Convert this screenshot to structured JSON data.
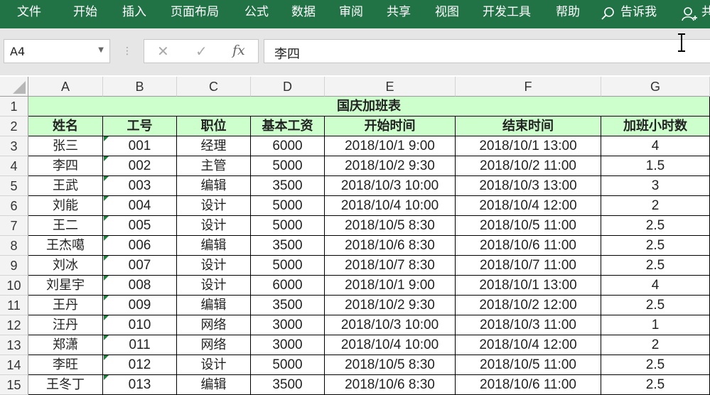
{
  "ribbon": {
    "tabs": [
      "文件",
      "开始",
      "插入",
      "页面布局",
      "公式",
      "数据",
      "审阅",
      "共享",
      "视图",
      "开发工具",
      "帮助"
    ],
    "tell_me": "告诉我",
    "share_partial": "共",
    "accent": "#217346"
  },
  "formula_bar": {
    "name_box": "A4",
    "cancel_icon": "✕",
    "enter_icon": "✓",
    "fx_label": "fx",
    "value": "李四"
  },
  "columns": [
    "A",
    "B",
    "C",
    "D",
    "E",
    "F",
    "G"
  ],
  "rows": [
    "1",
    "2",
    "3",
    "4",
    "5",
    "6",
    "7",
    "8",
    "9",
    "10",
    "11",
    "12",
    "13",
    "14",
    "15"
  ],
  "sheet": {
    "title": "国庆加班表",
    "headers": [
      "姓名",
      "工号",
      "职位",
      "基本工资",
      "开始时间",
      "结束时间",
      "加班小时数"
    ],
    "data": [
      [
        "张三",
        "001",
        "经理",
        "6000",
        "2018/10/1 9:00",
        "2018/10/1 13:00",
        "4"
      ],
      [
        "李四",
        "002",
        "主管",
        "5000",
        "2018/10/2 9:30",
        "2018/10/2 11:00",
        "1.5"
      ],
      [
        "王武",
        "003",
        "编辑",
        "3500",
        "2018/10/3 10:00",
        "2018/10/3 13:00",
        "3"
      ],
      [
        "刘能",
        "004",
        "设计",
        "5000",
        "2018/10/4 10:00",
        "2018/10/4 12:00",
        "2"
      ],
      [
        "王二",
        "005",
        "设计",
        "5000",
        "2018/10/5 8:30",
        "2018/10/5 11:00",
        "2.5"
      ],
      [
        "王杰噶",
        "006",
        "编辑",
        "3500",
        "2018/10/6 8:30",
        "2018/10/6 11:00",
        "2.5"
      ],
      [
        "刘冰",
        "007",
        "设计",
        "5000",
        "2018/10/7 8:30",
        "2018/10/7 11:00",
        "2.5"
      ],
      [
        "刘星宇",
        "008",
        "设计",
        "6000",
        "2018/10/1 9:00",
        "2018/10/1 13:00",
        "4"
      ],
      [
        "王丹",
        "009",
        "编辑",
        "3500",
        "2018/10/2 9:30",
        "2018/10/2 12:00",
        "2.5"
      ],
      [
        "汪丹",
        "010",
        "网络",
        "3000",
        "2018/10/3 10:00",
        "2018/10/3 11:00",
        "1"
      ],
      [
        "郑潇",
        "011",
        "网络",
        "3000",
        "2018/10/4 10:00",
        "2018/10/4 12:00",
        "2"
      ],
      [
        "李旺",
        "012",
        "设计",
        "5000",
        "2018/10/5 8:30",
        "2018/10/5 11:00",
        "2.5"
      ],
      [
        "王冬丁",
        "013",
        "编辑",
        "3500",
        "2018/10/6 8:30",
        "2018/10/6 11:00",
        "2.5"
      ]
    ]
  }
}
